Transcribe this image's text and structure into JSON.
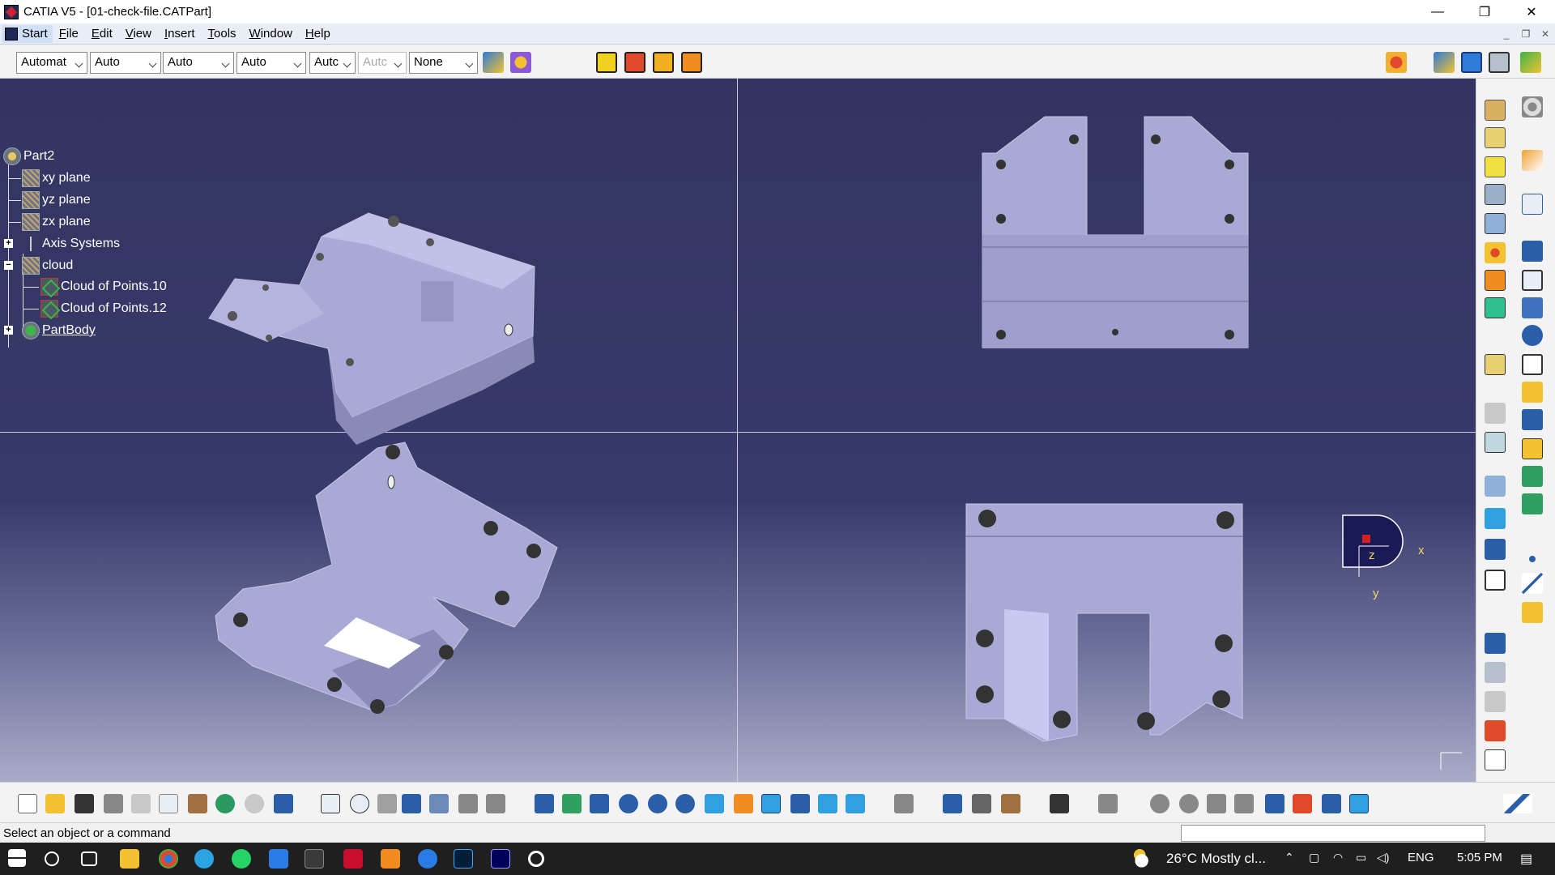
{
  "window": {
    "title": "CATIA V5 - [01-check-file.CATPart]",
    "minimize": "—",
    "restore": "❐",
    "close": "✕"
  },
  "menu": {
    "start": "Start",
    "items": [
      "File",
      "Edit",
      "View",
      "Insert",
      "Tools",
      "Window",
      "Help"
    ]
  },
  "toolbar": {
    "combos": [
      "Automat",
      "Auto",
      "Auto",
      "Auto",
      "Autc",
      "Autc",
      "None"
    ]
  },
  "tree": {
    "root": "Part2",
    "xy": "xy plane",
    "yz": "yz plane",
    "zx": "zx plane",
    "axis": "Axis Systems",
    "cloud": "cloud",
    "cloud10": "Cloud of Points.10",
    "cloud12": "Cloud of Points.12",
    "partbody": "PartBody"
  },
  "compass": {
    "x": "x",
    "y": "y",
    "z": "z"
  },
  "status": {
    "prompt": "Select an object or a command"
  },
  "taskbar": {
    "weather": "26°C  Mostly cl...",
    "lang": "ENG",
    "time": "5:05 PM"
  },
  "colors": {
    "viewport_top": "#333461",
    "viewport_bottom": "#a9abc8",
    "part": "#a8a8d6"
  }
}
